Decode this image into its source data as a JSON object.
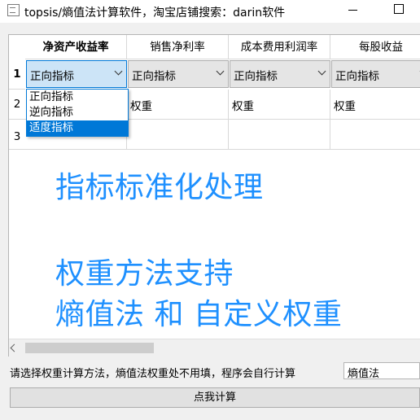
{
  "window": {
    "title": "topsis/熵值法计算软件，淘宝店铺搜索：darin软件",
    "app_icon": "app-icon",
    "minimize_icon": "minimize-icon",
    "maximize_icon": "maximize-icon"
  },
  "table": {
    "columns": [
      "净资产收益率",
      "销售净利率",
      "成本费用利润率",
      "每股收益"
    ],
    "rows": [
      "1",
      "2",
      "3"
    ],
    "row1_combos": [
      "正向指标",
      "正向指标",
      "正向指标",
      "正向指标"
    ],
    "row2_cells": [
      "",
      "权重",
      "权重",
      "权重"
    ],
    "dropdown_options": [
      "正向指标",
      "逆向指标",
      "适度指标"
    ],
    "dropdown_selected": "适度指标"
  },
  "notes": {
    "line1": "指标标准化处理",
    "line2": "权重方法支持",
    "line3": "熵值法 和 自定义权重"
  },
  "footer": {
    "hint": "请选择权重计算方法，熵值法权重处不用填，程序会自行计算",
    "method_value": "熵值法",
    "calc_button": "点我计算"
  },
  "colors": {
    "accent": "#0078d7",
    "note_text": "#1e90ff"
  }
}
